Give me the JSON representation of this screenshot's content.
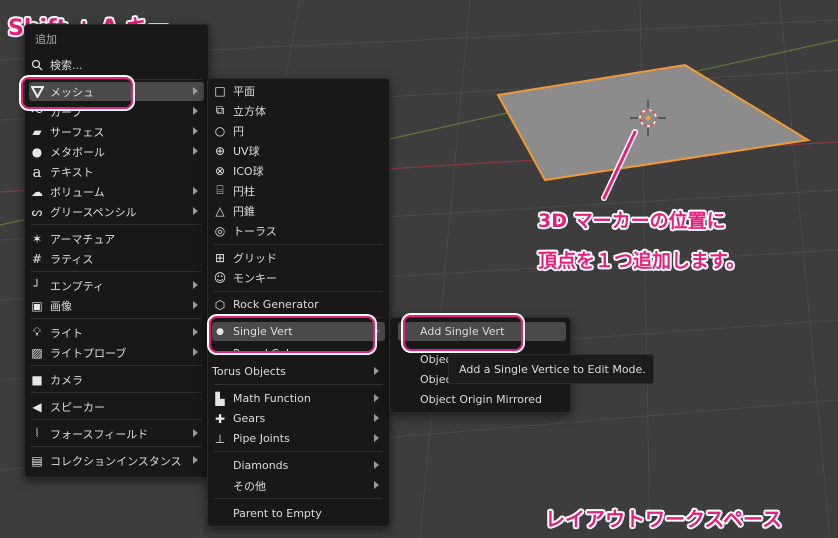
{
  "annotations": {
    "shortcut": "Shift + A キー",
    "marker_note_line1": "3D マーカーの位置に",
    "marker_note_line2": "頂点を１つ追加します。",
    "workspace_note": "レイアウトワークスペース",
    "accent_color": "#e8207d"
  },
  "add_menu": {
    "title": "追加",
    "search_placeholder": "検索...",
    "items": [
      {
        "label": "メッシュ",
        "icon": "mesh-icon"
      },
      {
        "label": "カーブ",
        "icon": "curve-icon"
      },
      {
        "label": "サーフェス",
        "icon": "surface-icon"
      },
      {
        "label": "メタボール",
        "icon": "metaball-icon"
      },
      {
        "label": "テキスト",
        "icon": "text-icon"
      },
      {
        "label": "ボリューム",
        "icon": "volume-icon"
      },
      {
        "label": "グリースペンシル",
        "icon": "grease-pencil-icon"
      },
      {
        "label": "アーマチュア",
        "icon": "armature-icon"
      },
      {
        "label": "ラティス",
        "icon": "lattice-icon"
      },
      {
        "label": "エンプティ",
        "icon": "empty-icon"
      },
      {
        "label": "画像",
        "icon": "image-icon"
      },
      {
        "label": "ライト",
        "icon": "light-icon"
      },
      {
        "label": "ライトプローブ",
        "icon": "light-probe-icon"
      },
      {
        "label": "カメラ",
        "icon": "camera-icon"
      },
      {
        "label": "スピーカー",
        "icon": "speaker-icon"
      },
      {
        "label": "フォースフィールド",
        "icon": "force-field-icon"
      },
      {
        "label": "コレクションインスタンス",
        "icon": "collection-icon"
      }
    ]
  },
  "mesh_menu": {
    "items": [
      {
        "label": "平面",
        "icon": "plane-icon"
      },
      {
        "label": "立方体",
        "icon": "cube-icon"
      },
      {
        "label": "円",
        "icon": "circle-icon"
      },
      {
        "label": "UV球",
        "icon": "uv-sphere-icon"
      },
      {
        "label": "ICO球",
        "icon": "ico-sphere-icon"
      },
      {
        "label": "円柱",
        "icon": "cylinder-icon"
      },
      {
        "label": "円錐",
        "icon": "cone-icon"
      },
      {
        "label": "トーラス",
        "icon": "torus-icon"
      },
      {
        "label": "グリッド",
        "icon": "grid-icon"
      },
      {
        "label": "モンキー",
        "icon": "monkey-icon"
      },
      {
        "label": "Rock Generator",
        "icon": "rock-icon"
      },
      {
        "label": "Single Vert",
        "icon": "vertex-dot-icon"
      },
      {
        "label": "Round Cube",
        "icon": ""
      },
      {
        "label": "Torus Objects",
        "icon": ""
      },
      {
        "label": "Math Function",
        "icon": "math-icon"
      },
      {
        "label": "Gears",
        "icon": "gears-icon"
      },
      {
        "label": "Pipe Joints",
        "icon": "pipe-icon"
      },
      {
        "label": "Diamonds",
        "icon": ""
      },
      {
        "label": "その他",
        "icon": ""
      },
      {
        "label": "Parent to Empty",
        "icon": ""
      }
    ]
  },
  "single_vert_menu": {
    "items": [
      {
        "label": "Add Single Vert"
      },
      {
        "label": "Object"
      },
      {
        "label": "Object Origin"
      },
      {
        "label": "Object Origin Mirrored"
      }
    ]
  },
  "tooltip": {
    "text": "Add a Single Vertice to Edit Mode."
  },
  "colors": {
    "viewport_bg": "#3d3d3d",
    "plane_fill": "#8c8c8c",
    "selection_outline": "#f09a35",
    "axis_red": "#c64b4b",
    "axis_green": "#7aa33c"
  }
}
